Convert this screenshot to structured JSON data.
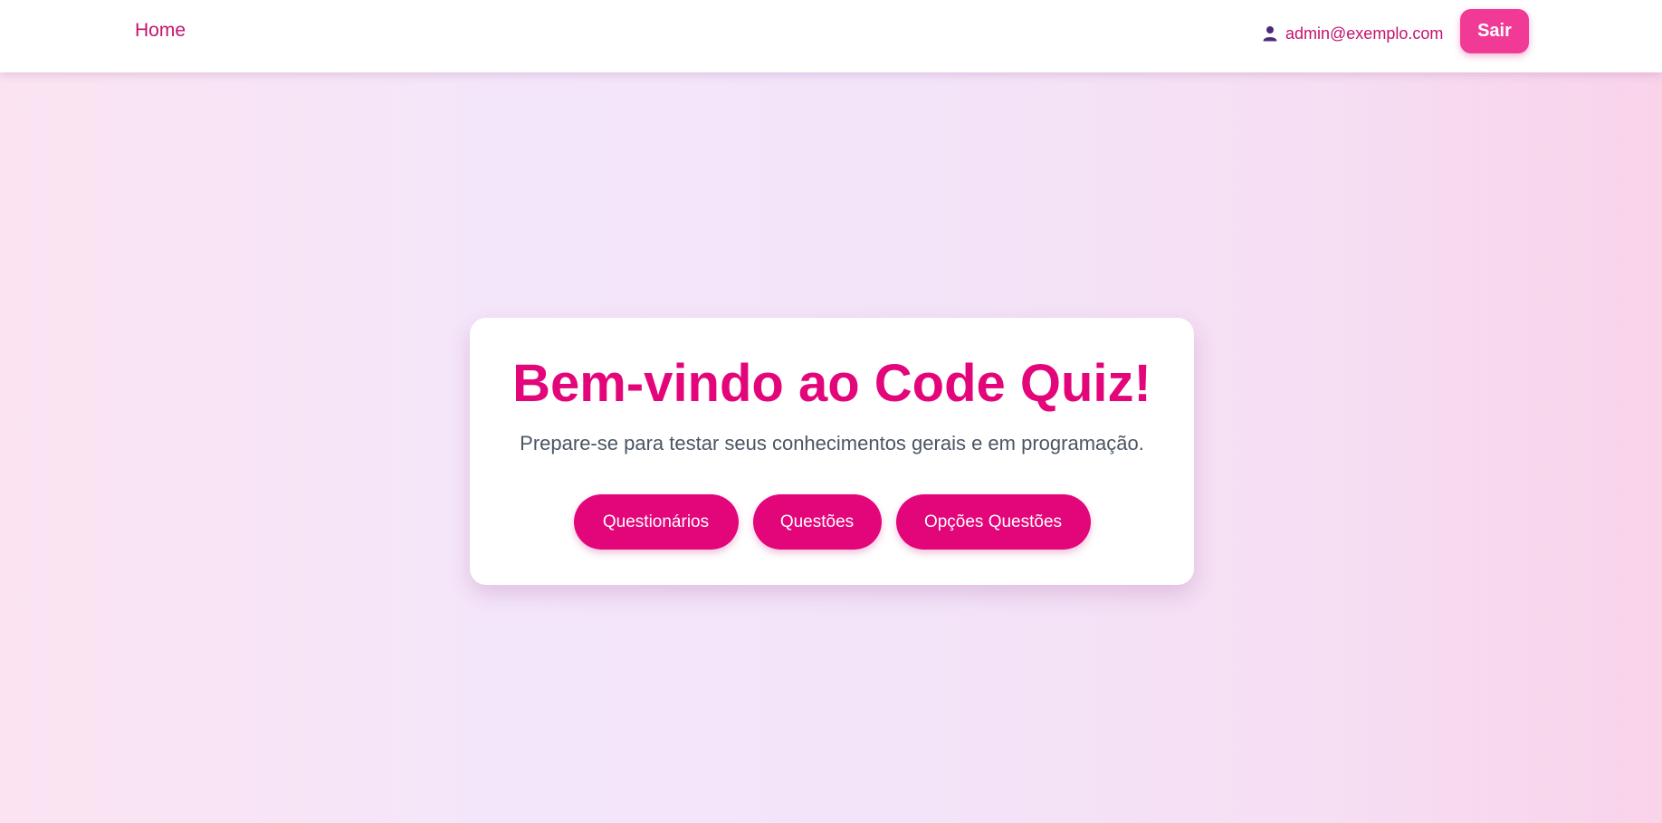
{
  "nav": {
    "home_label": "Home",
    "user_icon": "user-icon",
    "user_email": "admin@exemplo.com",
    "logout_label": "Sair"
  },
  "card": {
    "title": "Bem-vindo ao Code Quiz!",
    "subtitle": "Prepare-se para testar seus conhecimentos gerais e em programação.",
    "buttons": [
      {
        "label": "Questionários"
      },
      {
        "label": "Questões"
      },
      {
        "label": "Opções Questões"
      }
    ]
  },
  "colors": {
    "accent": "#e3067a",
    "logout_button": "#f03a96",
    "text_muted": "#4b5563",
    "user_icon": "#4c2a7a"
  }
}
